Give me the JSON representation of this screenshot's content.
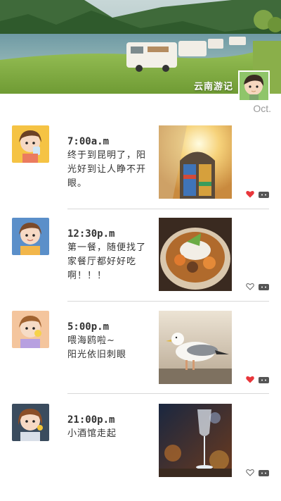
{
  "header": {
    "title": "云南游记",
    "month": "Oct."
  },
  "entries": [
    {
      "time": "7:00a.m",
      "text": "终于到昆明了，阳光好到让人睁不开眼。",
      "liked": true
    },
    {
      "time": "12:30p.m",
      "text": "第一餐，随便找了家餐厅都好好吃啊！！！",
      "liked": false
    },
    {
      "time": "5:00p.m",
      "text": "喂海鸥啦~\n阳光依旧刺眼",
      "liked": true
    },
    {
      "time": "21:00p.m",
      "text": "小酒馆走起",
      "liked": false
    }
  ],
  "colors": {
    "heart_liked": "#e8363b",
    "heart_unliked": "#666666",
    "divider": "#d8d8d8"
  }
}
